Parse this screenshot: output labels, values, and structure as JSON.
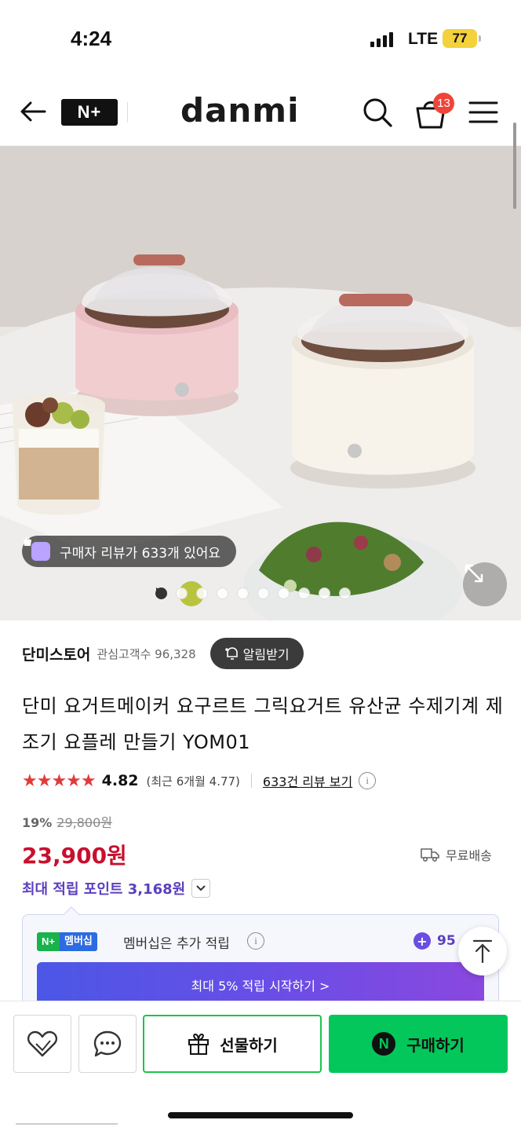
{
  "status": {
    "time": "4:24",
    "network": "LTE",
    "battery": "77"
  },
  "header": {
    "nplus": "N+",
    "brand": "danmi",
    "cart_count": "13"
  },
  "hero": {
    "review_pill": "구매자 리뷰가 633개 있어요",
    "slide_count": 10,
    "active_slide": 1
  },
  "store": {
    "name": "단미스토어",
    "followers": "관심고객수 96,328",
    "notify_label": "알림받기"
  },
  "product": {
    "title": "단미 요거트메이커 요구르트 그릭요거트 유산균 수제기계 제조기 요플레 만들기 YOM01",
    "rating": "4.82",
    "rating_stars": "★★★★★",
    "recent_rating": "(최근 6개월 4.77)",
    "review_link": "633건 리뷰 보기",
    "discount": "19%",
    "original_price": "29,800원",
    "price": "23,900원",
    "shipping": "무료배송",
    "points": "최대 적립 포인트 3,168원"
  },
  "membership": {
    "badge_n": "N+",
    "badge_label": "멤버십",
    "text": "멤버십은 추가 적립",
    "extra": "95",
    "cta": "최대 5% 적립 시작하기 >"
  },
  "bottom": {
    "gift": "선물하기",
    "buy": "구매하기"
  },
  "colors": {
    "price": "#c8102e",
    "points": "#5b3fc0",
    "buy": "#03c75a",
    "badge": "#f04438"
  }
}
